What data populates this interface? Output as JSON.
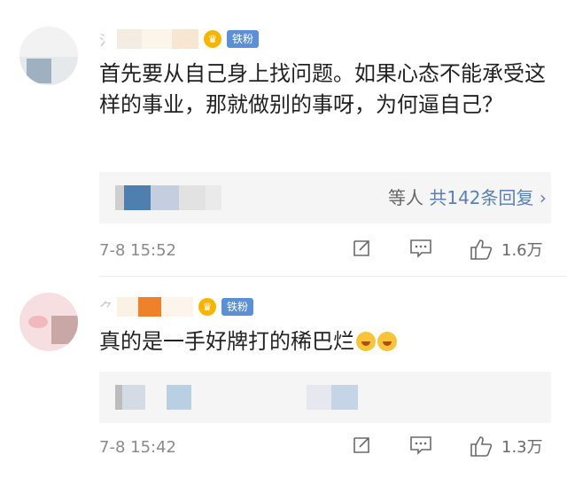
{
  "comments": [
    {
      "fan_badge": "铁粉",
      "text": "首先要从自己身上找问题。如果心态不能承受这样的事业，那就做别的事呀，为何逼自己？",
      "replies_prefix": "等人",
      "replies_label": "共142条回复",
      "time": "7-8 15:52",
      "likes": "1.6万"
    },
    {
      "fan_badge": "铁粉",
      "text": "真的是一手好牌打的稀巴烂",
      "emoji_names": [
        "laughing-emoji",
        "laughing-emoji"
      ],
      "time": "7-8 15:42",
      "likes": "1.3万"
    }
  ],
  "icons": {
    "crown": "crown-icon",
    "forward": "forward-icon",
    "comment": "comment-icon",
    "like": "thumbs-up-icon",
    "chevron": "chevron-right-icon"
  },
  "colors": {
    "fan_badge": "#5b8fd6",
    "reply_link": "#5b80b5",
    "crown": "#f7b500",
    "meta": "#8a8a8a"
  }
}
